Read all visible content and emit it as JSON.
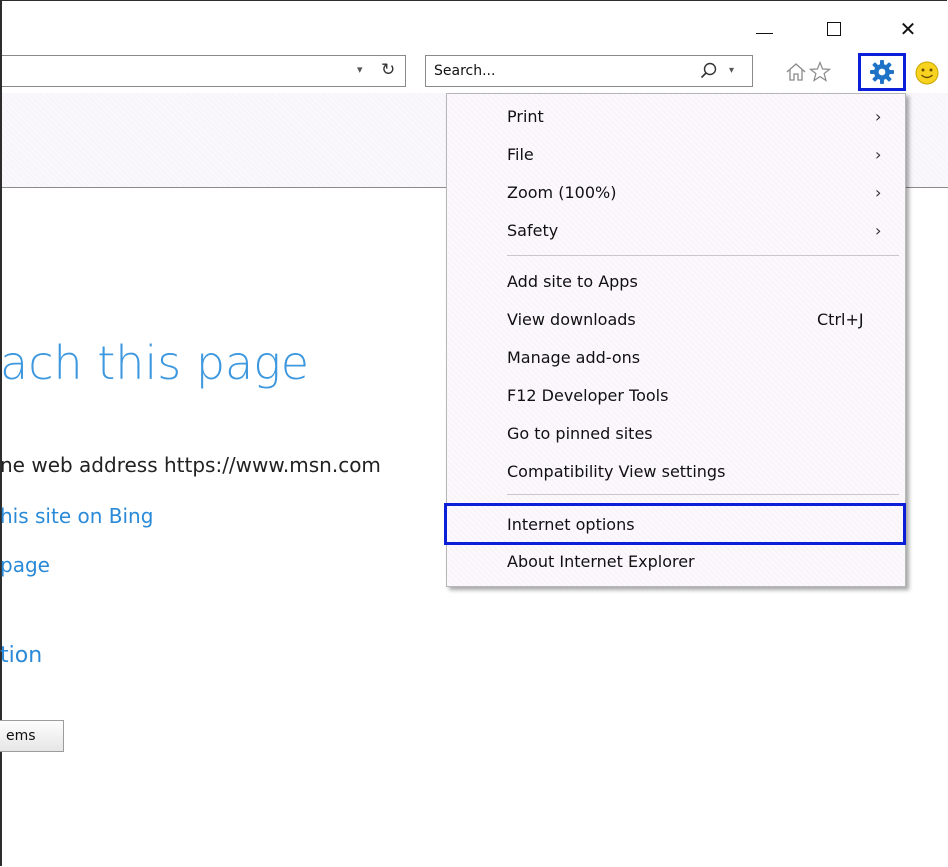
{
  "window": {
    "minimize_glyph": "—",
    "close_glyph": "✕"
  },
  "address_bar": {
    "dropdown_glyph": "▾",
    "refresh_glyph": "↻"
  },
  "search": {
    "placeholder": "Search...",
    "dropdown_glyph": "▾"
  },
  "toolbar": {
    "icons": [
      "home-icon",
      "favorites-star-icon",
      "tools-gear-icon",
      "feedback-smiley-icon"
    ],
    "highlight_color": "#0b1fd8",
    "gear_color": "#1f73c7"
  },
  "page": {
    "heading": "ach this page",
    "line1": "ne web address https://www.msn.com",
    "link1": "his site on Bing",
    "link2": "page",
    "section": "tion",
    "button_label": "ems",
    "accent_color": "#2a8ad8"
  },
  "menu": {
    "arrow_glyph": "›",
    "items": [
      {
        "label": "Print"
      },
      {
        "label": "File"
      },
      {
        "label": "Zoom (100%)"
      },
      {
        "label": "Safety"
      },
      {
        "label": "Add site to Apps"
      },
      {
        "label": "View downloads",
        "shortcut": "Ctrl+J"
      },
      {
        "label": "Manage add-ons"
      },
      {
        "label": "F12 Developer Tools"
      },
      {
        "label": "Go to pinned sites"
      },
      {
        "label": "Compatibility View settings"
      },
      {
        "label": "Internet options"
      },
      {
        "label": "About Internet Explorer"
      }
    ]
  }
}
